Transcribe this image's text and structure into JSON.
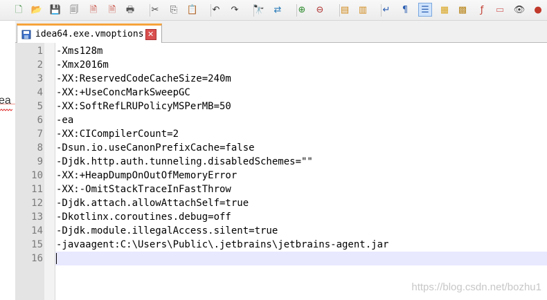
{
  "toolbar": {
    "buttons": [
      {
        "name": "new-file-icon",
        "glyph": "🗋",
        "color": "#3a8a3a"
      },
      {
        "name": "open-file-icon",
        "glyph": "📂",
        "color": "#d79a1c"
      },
      {
        "name": "save-icon",
        "glyph": "💾",
        "color": "#555"
      },
      {
        "name": "save-all-icon",
        "glyph": "🗐",
        "color": "#555"
      },
      {
        "name": "close-file-icon",
        "glyph": "🗎",
        "color": "#c0392b"
      },
      {
        "name": "close-all-icon",
        "glyph": "🗎",
        "color": "#c0392b"
      },
      {
        "name": "print-icon",
        "glyph": "🖶",
        "color": "#555"
      },
      {
        "name": "cut-icon",
        "glyph": "✂",
        "color": "#444"
      },
      {
        "name": "copy-icon",
        "glyph": "⎘",
        "color": "#444"
      },
      {
        "name": "paste-icon",
        "glyph": "📋",
        "color": "#555"
      },
      {
        "name": "undo-icon",
        "glyph": "↶",
        "color": "#333"
      },
      {
        "name": "redo-icon",
        "glyph": "↷",
        "color": "#333"
      },
      {
        "name": "find-icon",
        "glyph": "🔭",
        "color": "#333"
      },
      {
        "name": "replace-icon",
        "glyph": "⇄",
        "color": "#2a7ab8"
      },
      {
        "name": "zoom-in-icon",
        "glyph": "⊕",
        "color": "#2e8b2e"
      },
      {
        "name": "zoom-out-icon",
        "glyph": "⊖",
        "color": "#b03030"
      },
      {
        "name": "sync-vertical-icon",
        "glyph": "▤",
        "color": "#d08a1c"
      },
      {
        "name": "sync-horizontal-icon",
        "glyph": "▥",
        "color": "#d08a1c"
      },
      {
        "name": "word-wrap-icon",
        "glyph": "↵",
        "color": "#2a5db0"
      },
      {
        "name": "show-all-characters-icon",
        "glyph": "¶",
        "color": "#2a5db0"
      },
      {
        "name": "indent-guide-icon",
        "glyph": "☰",
        "color": "#2a5db0"
      },
      {
        "name": "user-language-icon",
        "glyph": "▦",
        "color": "#d9a520"
      },
      {
        "name": "doc-map-icon",
        "glyph": "▩",
        "color": "#b8861c"
      },
      {
        "name": "function-list-icon",
        "glyph": "ƒ",
        "color": "#c0392b"
      },
      {
        "name": "folder-workspace-icon",
        "glyph": "▭",
        "color": "#d46a6a"
      },
      {
        "name": "monitoring-icon",
        "glyph": "👁",
        "color": "#444"
      },
      {
        "name": "record-macro-icon",
        "glyph": "●",
        "color": "#c0392b"
      }
    ]
  },
  "background_window": {
    "text": "ea"
  },
  "tab": {
    "title": "idea64.exe.vmoptions",
    "close_glyph": "✕"
  },
  "editor": {
    "lines": [
      {
        "number": "1",
        "text": "-Xms128m"
      },
      {
        "number": "2",
        "text": "-Xmx2016m"
      },
      {
        "number": "3",
        "text": "-XX:ReservedCodeCacheSize=240m"
      },
      {
        "number": "4",
        "text": "-XX:+UseConcMarkSweepGC"
      },
      {
        "number": "5",
        "text": "-XX:SoftRefLRUPolicyMSPerMB=50"
      },
      {
        "number": "6",
        "text": "-ea"
      },
      {
        "number": "7",
        "text": "-XX:CICompilerCount=2"
      },
      {
        "number": "8",
        "text": "-Dsun.io.useCanonPrefixCache=false"
      },
      {
        "number": "9",
        "text": "-Djdk.http.auth.tunneling.disabledSchemes=\"\""
      },
      {
        "number": "10",
        "text": "-XX:+HeapDumpOnOutOfMemoryError"
      },
      {
        "number": "11",
        "text": "-XX:-OmitStackTraceInFastThrow"
      },
      {
        "number": "12",
        "text": "-Djdk.attach.allowAttachSelf=true"
      },
      {
        "number": "13",
        "text": "-Dkotlinx.coroutines.debug=off"
      },
      {
        "number": "14",
        "text": "-Djdk.module.illegalAccess.silent=true"
      },
      {
        "number": "15",
        "text": "-javaagent:C:\\Users\\Public\\.jetbrains\\jetbrains-agent.jar"
      },
      {
        "number": "16",
        "text": ""
      }
    ],
    "current_line": "16"
  },
  "watermark": "https://blog.csdn.net/bozhu1"
}
